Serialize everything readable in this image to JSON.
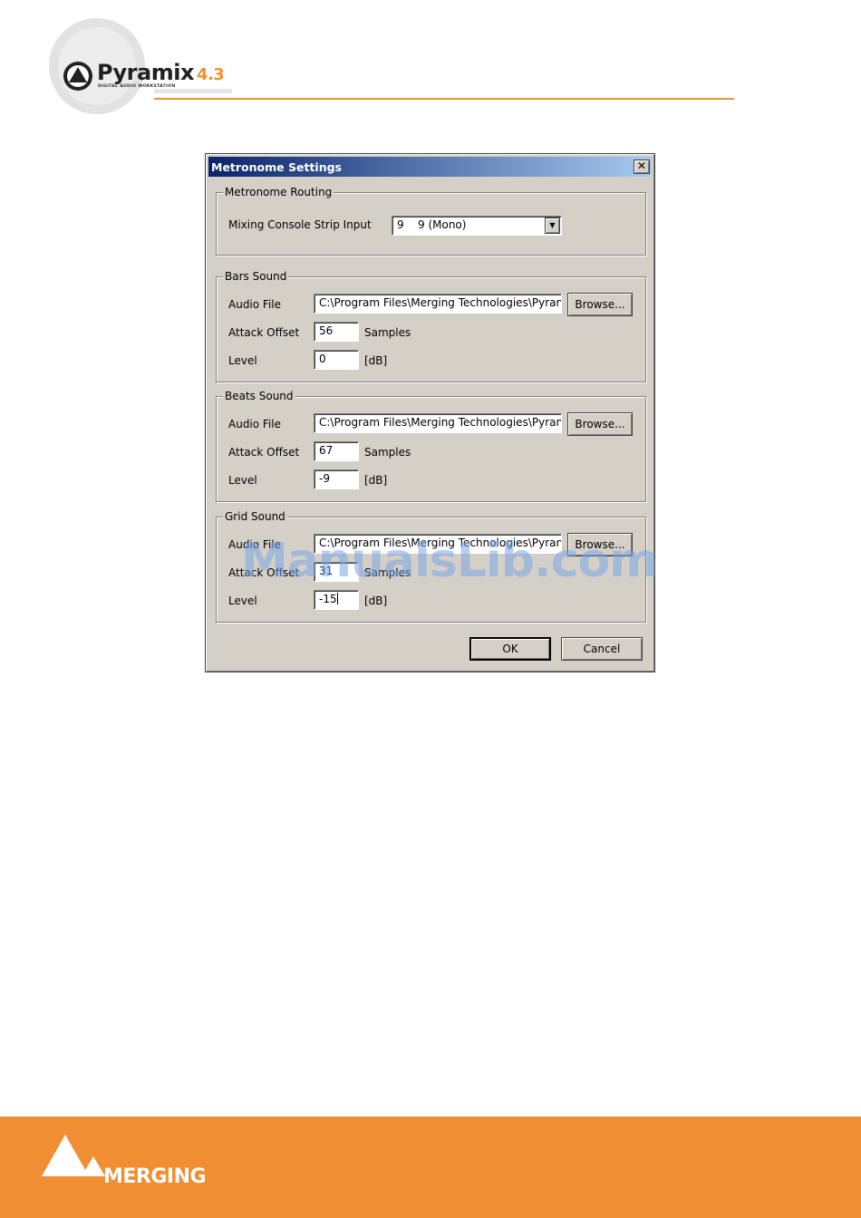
{
  "header": {
    "brand": "Pyramix",
    "version": "4.3",
    "tagline": "DIGITAL AUDIO WORKSTATION"
  },
  "dialog": {
    "title": "Metronome Settings",
    "close_glyph": "✕",
    "routing": {
      "legend": "Metronome Routing",
      "strip_input_label": "Mixing Console Strip Input",
      "strip_input_number": "9",
      "strip_input_value": "9 (Mono)",
      "dropdown_glyph": "▼"
    },
    "bars": {
      "legend": "Bars Sound",
      "audio_file_label": "Audio File",
      "audio_file_value": "C:\\Program Files\\Merging Technologies\\Pyran",
      "browse_label": "Browse...",
      "attack_offset_label": "Attack Offset",
      "attack_offset_value": "56",
      "attack_offset_unit": "Samples",
      "level_label": "Level",
      "level_value": "0",
      "level_unit": "[dB]"
    },
    "beats": {
      "legend": "Beats Sound",
      "audio_file_label": "Audio File",
      "audio_file_value": "C:\\Program Files\\Merging Technologies\\Pyran",
      "browse_label": "Browse...",
      "attack_offset_label": "Attack Offset",
      "attack_offset_value": "67",
      "attack_offset_unit": "Samples",
      "level_label": "Level",
      "level_value": "-9",
      "level_unit": "[dB]"
    },
    "grid": {
      "legend": "Grid Sound",
      "audio_file_label": "Audio File",
      "audio_file_value": "C:\\Program Files\\Merging Technologies\\Pyran",
      "browse_label": "Browse...",
      "attack_offset_label": "Attack Offset",
      "attack_offset_value": "31",
      "attack_offset_unit": "Samples",
      "level_label": "Level",
      "level_value": "-15",
      "level_unit": "[dB]"
    },
    "ok_label": "OK",
    "cancel_label": "Cancel"
  },
  "watermark": "ManualsLib.com",
  "footer": {
    "brand": "MERGING"
  },
  "colors": {
    "accent_orange": "#ef8e32",
    "dialog_face": "#d4d0c8",
    "titlebar_start": "#0a246a",
    "titlebar_end": "#a6caf0"
  }
}
